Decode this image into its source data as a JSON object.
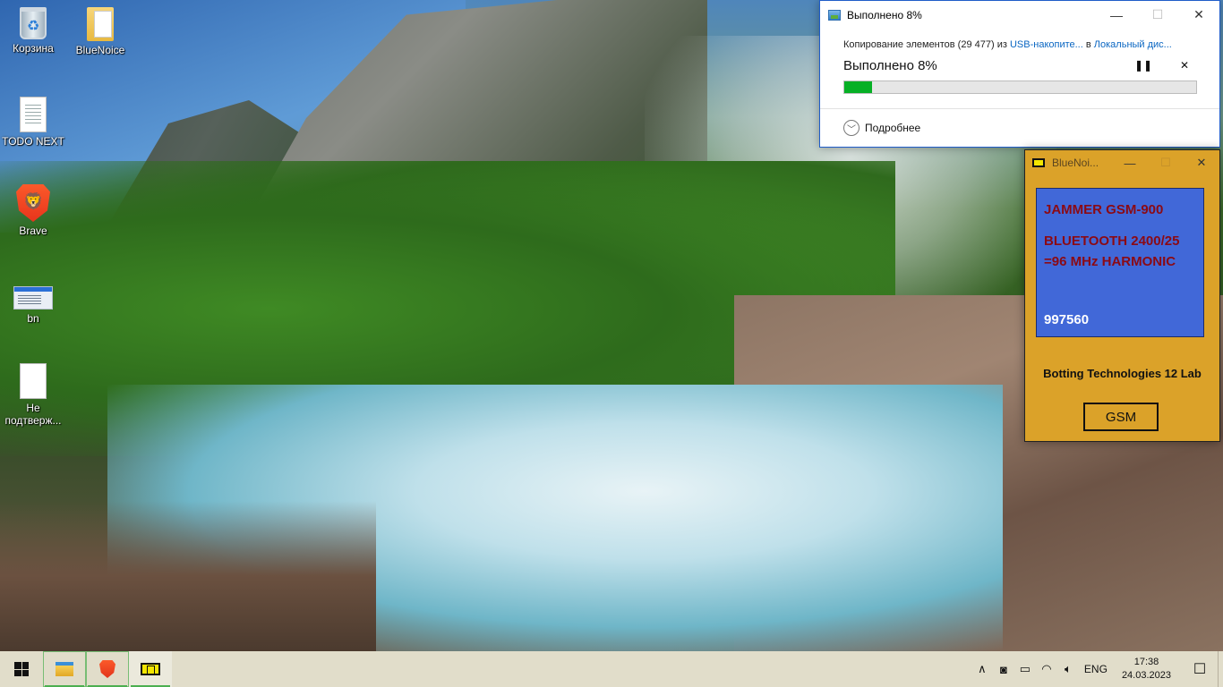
{
  "desktop": {
    "icons": [
      {
        "label": "Корзина",
        "icon": "recycle-bin-icon"
      },
      {
        "label": "BlueNoice",
        "icon": "folder-icon"
      },
      {
        "label": "TODO NEXT",
        "icon": "text-document-icon"
      },
      {
        "label": "Brave",
        "icon": "brave-browser-icon"
      },
      {
        "label": "bn",
        "icon": "app-window-icon"
      },
      {
        "label": "Не подтверж...",
        "icon": "blank-file-icon"
      }
    ]
  },
  "copy_dialog": {
    "title": "Выполнено 8%",
    "description_prefix": "Копирование элементов (29 477) из ",
    "source_link": "USB-накопите...",
    "between": " в ",
    "dest_link": "Локальный дис...",
    "progress_title": "Выполнено 8%",
    "progress_percent": 8,
    "pause_symbol": "❚❚",
    "cancel_symbol": "✕",
    "details_label": "Подробнее",
    "accent": "#06b025"
  },
  "bluenoice": {
    "title": "BlueNoi...",
    "line1": "JAMMER GSM-900",
    "line2": "BLUETOOTH 2400/25",
    "line3": "=96 MHz HARMONIC",
    "value": "997560",
    "company": "Botting Technologies 12 Lab",
    "button": "GSM",
    "bg_color": "#dba229",
    "panel_color": "#4168d8",
    "text_color": "#8b0a14"
  },
  "window_controls": {
    "minimize": "—",
    "maximize": "☐",
    "close": "✕"
  },
  "taskbar": {
    "tray_up_arrow": "∧",
    "language": "ENG",
    "time": "17:38",
    "date": "24.03.2023",
    "notifications_symbol": "☐"
  }
}
